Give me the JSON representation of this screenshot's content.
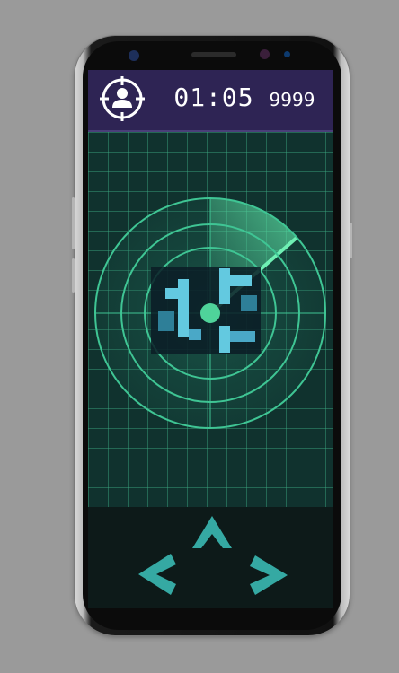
{
  "hud": {
    "timer": "01:05",
    "score": "9999",
    "avatar_icon": "crosshair-user-icon"
  },
  "controls": {
    "up_icon": "chevron-up-icon",
    "left_icon": "chevron-left-icon",
    "right_icon": "chevron-right-icon"
  },
  "colors": {
    "hud_bg": "#2e2454",
    "radar_accent": "#5ee6a8",
    "arrow": "#35a9a3",
    "screen_bg": "#10322e"
  }
}
